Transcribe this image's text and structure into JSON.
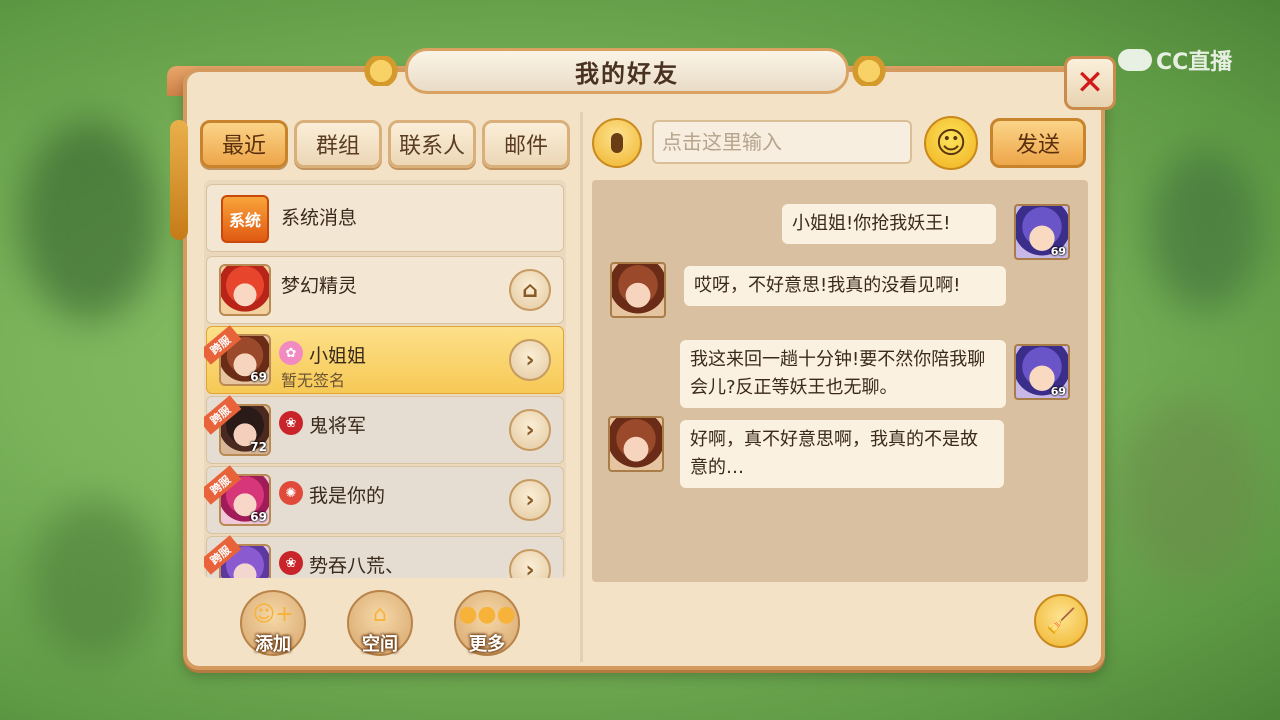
{
  "watermark": {
    "text": "CC直播"
  },
  "window": {
    "title": "我的好友",
    "close_icon": "close-icon"
  },
  "tabs": [
    {
      "label": "最近",
      "active": true
    },
    {
      "label": "群组",
      "active": false
    },
    {
      "label": "联系人",
      "active": false
    },
    {
      "label": "邮件",
      "active": false
    }
  ],
  "contacts": [
    {
      "name": "系统消息",
      "icon_text": "系统",
      "type": "system"
    },
    {
      "name": "梦幻精灵",
      "action_icon": "home-icon"
    },
    {
      "name": "小姐姐",
      "status": "暂无签名",
      "level": "69",
      "tag": "跨服",
      "selected": true,
      "badge_icon": "lotus-icon"
    },
    {
      "name": "鬼将军",
      "level": "72",
      "tag": "跨服",
      "badge_icon": "flower-icon"
    },
    {
      "name": "我是你的",
      "level": "69",
      "tag": "跨服",
      "badge_icon": "sect-icon"
    },
    {
      "name": "势吞八荒、",
      "tag": "跨服",
      "badge_icon": "flower-icon"
    }
  ],
  "bottom_buttons": [
    {
      "label": "添加",
      "icon": "add-friend-icon"
    },
    {
      "label": "空间",
      "icon": "house-icon"
    },
    {
      "label": "更多",
      "icon": "more-dots-icon"
    }
  ],
  "chat_input": {
    "placeholder": "点击这里输入",
    "value": ""
  },
  "send_label": "发送",
  "messages": [
    {
      "side": "right",
      "text": "小姐姐!你抢我妖王!",
      "level": "69"
    },
    {
      "side": "left",
      "text": "哎呀，不好意思!我真的没看见啊!"
    },
    {
      "side": "right",
      "text": "我这来回一趟十分钟!要不然你陪我聊会儿?反正等妖王也无聊。",
      "level": "69"
    },
    {
      "side": "left",
      "text": "好啊，真不好意思啊，我真的不是故意的…"
    }
  ],
  "colors": {
    "accent": "#f0b42c",
    "frame": "#d49a5e",
    "close": "#d21a1a",
    "cross_server_tag": "#e8623a"
  }
}
